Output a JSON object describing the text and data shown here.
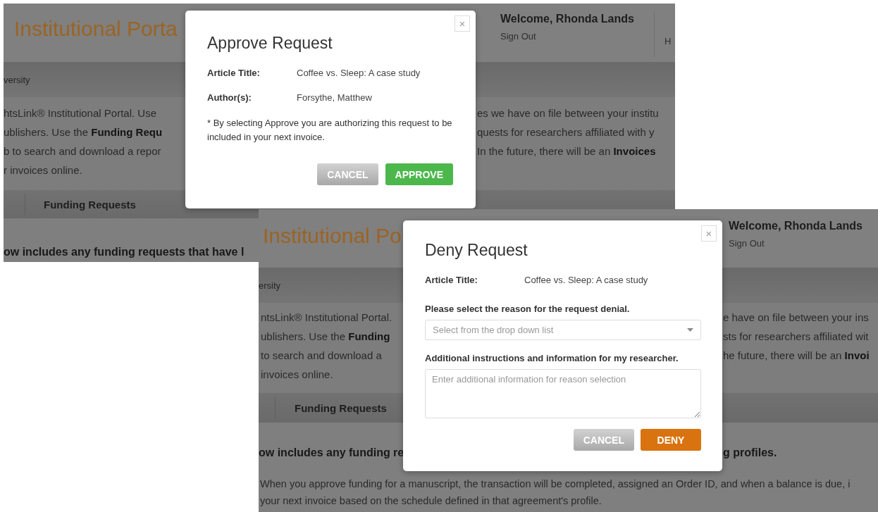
{
  "approve_screenshot": {
    "portal_title": "Institutional Porta",
    "welcome": "Welcome, Rhonda Lands",
    "sign_out": "Sign Out",
    "help_label": "H",
    "org_name": "versity",
    "intro_left": [
      "htsLink® Institutional Portal. Use",
      "ublishers. Use the **Funding Requ**",
      "b to search and download a repor",
      "r invoices online."
    ],
    "intro_right": [
      "es we have on file between your institu",
      "quests for researchers affiliated with y",
      "In the future, there will be an **Invoices**"
    ],
    "tab": "Funding Requests",
    "heading": "ow includes any funding requests that have l",
    "dialog": {
      "close": "×",
      "title": "Approve Request",
      "fields": [
        {
          "label": "Article Title:",
          "value": "Coffee vs. Sleep: A case study"
        },
        {
          "label": "Author(s):",
          "value": "Forsythe, Matthew"
        }
      ],
      "note": "* By selecting Approve you are authorizing this request to be included in your next invoice.",
      "buttons": [
        {
          "label": "CANCEL",
          "kind": "cancel"
        },
        {
          "label": "APPROVE",
          "kind": "approve"
        }
      ]
    }
  },
  "deny_screenshot": {
    "portal_title": "Institutional Po",
    "welcome": "Welcome, Rhonda Lands",
    "sign_out": "Sign Out",
    "org_name": "ersity",
    "intro_left": [
      "ntsLink® Institutional Portal.",
      "ublishers. Use the **Funding**",
      "to search and download a",
      "invoices online."
    ],
    "intro_right": [
      "e have on file between your ins",
      "sts for researchers affiliated wit",
      "he future, there will be an **Invoi**"
    ],
    "tab": "Funding Requests",
    "heading_left": "ow includes any funding re",
    "heading_right": "g profiles.",
    "paragraph": [
      "When you approve funding for a manuscript, the transaction will be completed, assigned an Order ID, and when a balance is due, i",
      "your next invoice based on the schedule defined in that agreement's profile."
    ],
    "dialog": {
      "close": "×",
      "title": "Deny Request",
      "fields": [
        {
          "label": "Article Title:",
          "value": "Coffee vs. Sleep: A case study"
        }
      ],
      "reason": {
        "label": "Please select the reason for the request denial.",
        "placeholder": "Select from the drop down list"
      },
      "instructions": {
        "label": "Additional instructions and information for my researcher.",
        "placeholder": "Enter additional information for reason selection"
      },
      "buttons": [
        {
          "label": "CANCEL",
          "kind": "cancel"
        },
        {
          "label": "DENY",
          "kind": "deny"
        }
      ]
    }
  }
}
